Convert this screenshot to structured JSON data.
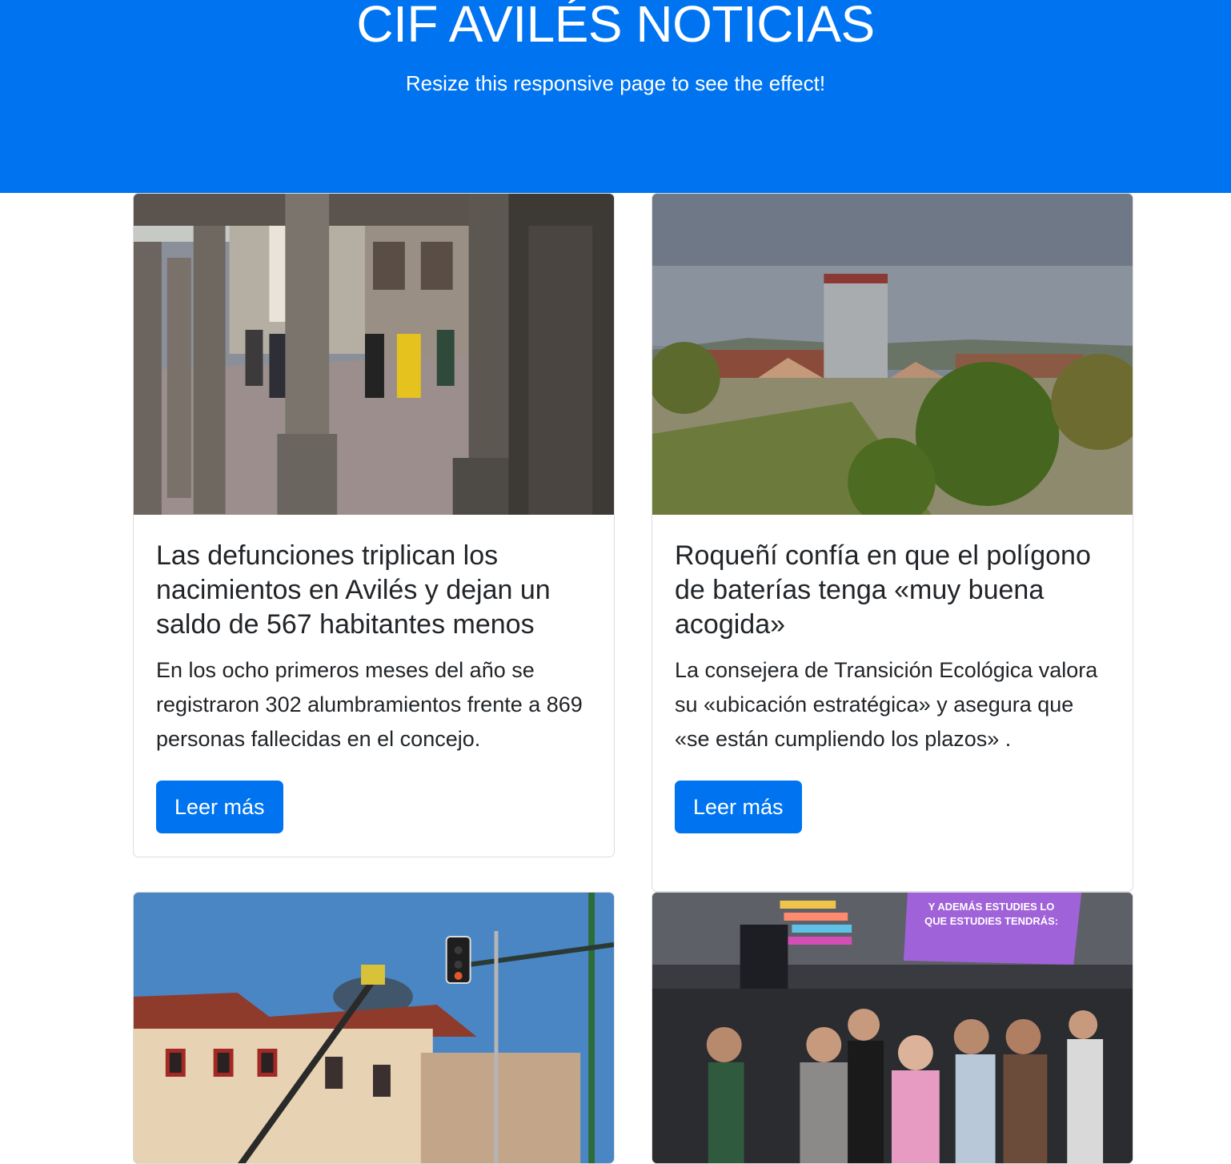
{
  "header": {
    "title": "CIF AVILÉS NOTICIAS",
    "subtitle": "Resize this responsive page to see the effect!"
  },
  "articles": [
    {
      "title": "Las defunciones triplican los nacimientos en Avilés y dejan un saldo de 567 habitantes menos",
      "summary": "En los ocho primeros meses del año se registraron 302 alumbramientos frente a 869 personas fallecidas en el concejo.",
      "button_label": "Leer más"
    },
    {
      "title": "Roqueñí confía en que el polígono de baterías tenga «muy buena acogida»",
      "summary": "La consejera de Transición Ecológica valora su «ubicación estratégica» y asegura que «se están cumpliendo los plazos» .",
      "button_label": "Leer más"
    },
    {
      "title": "",
      "summary": "",
      "button_label": ""
    },
    {
      "title": "",
      "summary": "",
      "button_label": "",
      "image_banner_text": "Y ADEMÁS ESTUDIES LO QUE ESTUDIES TENDRÁS:"
    }
  ],
  "colors": {
    "primary": "#0074f0",
    "text": "#212529",
    "card_border": "#dcdcdc"
  }
}
